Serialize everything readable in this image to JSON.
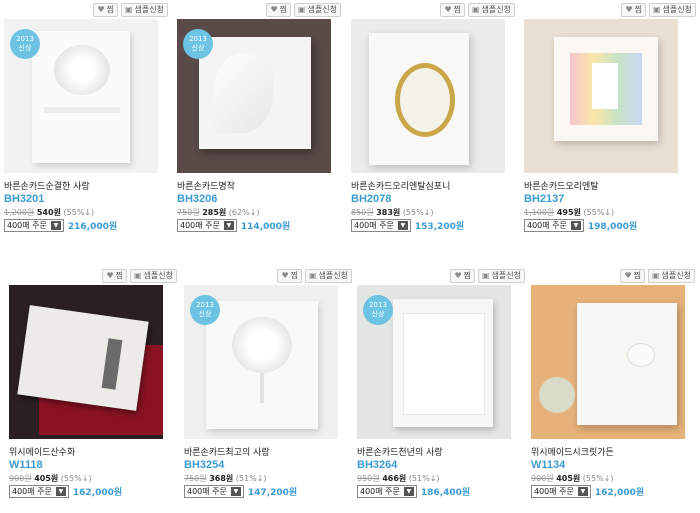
{
  "actions": {
    "wish_label": "찜",
    "sample_label": "샘플신청",
    "heart_icon": "heart-icon",
    "box_icon": "box-icon"
  },
  "badge": {
    "year": "2013",
    "text": "신상"
  },
  "products": [
    {
      "name": "바른손카드순결한 사랑",
      "code": "BH3201",
      "old_price": "1,200원",
      "new_price": "540원",
      "discount": "(55%↓)",
      "qty": "400매 주문",
      "total": "216,000원",
      "badge": true,
      "bg": "#f2f2f2",
      "card": "#fbfbfb"
    },
    {
      "name": "바른손카드명작",
      "code": "BH3206",
      "old_price": "750원",
      "new_price": "285원",
      "discount": "(62%↓)",
      "qty": "400매 주문",
      "total": "114,000원",
      "badge": true,
      "bg": "#5a4b48",
      "card": "#f4f4f4"
    },
    {
      "name": "바른손카드오리엔탈심포니",
      "code": "BH2078",
      "old_price": "850원",
      "new_price": "383원",
      "discount": "(55%↓)",
      "qty": "400매 주문",
      "total": "153,200원",
      "badge": false,
      "bg": "#e9ece8",
      "card": "#f8f8f6"
    },
    {
      "name": "바른손카드오리엔탈",
      "code": "BH2137",
      "old_price": "1,100원",
      "new_price": "495원",
      "discount": "(55%↓)",
      "qty": "400매 주문",
      "total": "198,000원",
      "badge": false,
      "bg": "#eadfd3",
      "card": "#fbf8f3"
    },
    {
      "name": "위시메이드산수화",
      "code": "W1118",
      "old_price": "900원",
      "new_price": "405원",
      "discount": "(55%↓)",
      "qty": "400매 주문",
      "total": "162,000원",
      "badge": false,
      "bg": "#2b1f22",
      "card": "#ecebe8"
    },
    {
      "name": "바른손카드최고의 사랑",
      "code": "BH3254",
      "old_price": "750원",
      "new_price": "368원",
      "discount": "(51%↓)",
      "qty": "400매 주문",
      "total": "147,200원",
      "badge": true,
      "bg": "#efefef",
      "card": "#f9f9f9"
    },
    {
      "name": "바른손카드천년의 사랑",
      "code": "BH3264",
      "old_price": "950원",
      "new_price": "466원",
      "discount": "(51%↓)",
      "qty": "400매 주문",
      "total": "186,400원",
      "badge": true,
      "bg": "#e4e6e3",
      "card": "#f7f7f7"
    },
    {
      "name": "위시메이드시크릿가든",
      "code": "W1134",
      "old_price": "900원",
      "new_price": "405원",
      "discount": "(55%↓)",
      "qty": "400매 주문",
      "total": "162,000원",
      "badge": false,
      "bg": "#e7b27a",
      "card": "#f6f6f3"
    }
  ]
}
